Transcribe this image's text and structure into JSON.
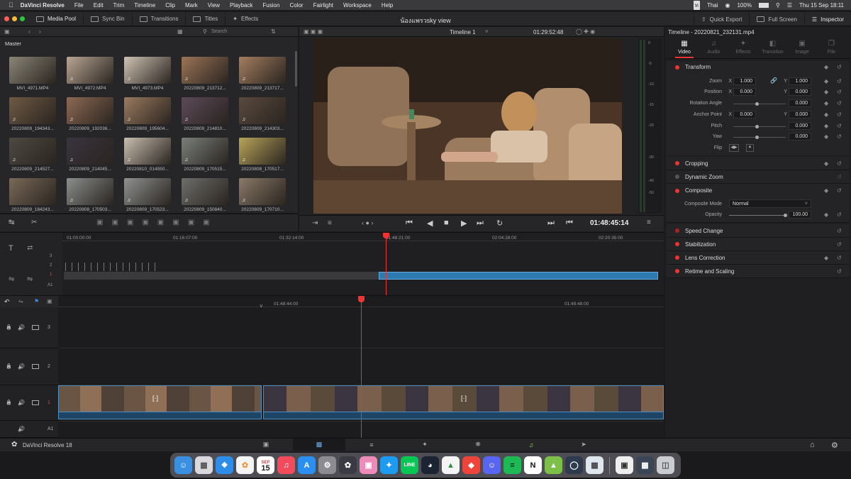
{
  "menubar": {
    "app_name": "DaVinci Resolve",
    "items": [
      "File",
      "Edit",
      "Trim",
      "Timeline",
      "Clip",
      "Mark",
      "View",
      "Playback",
      "Fusion",
      "Color",
      "Fairlight",
      "Workspace",
      "Help"
    ],
    "input_source": "Thai",
    "battery": "100%",
    "datetime": "Thu 15 Sep 18:11"
  },
  "toolbar": {
    "media_pool": "Media Pool",
    "sync_bin": "Sync Bin",
    "transitions": "Transitions",
    "titles": "Titles",
    "effects": "Effects",
    "project_title": "น้องแพรวsky view",
    "quick_export": "Quick Export",
    "full_screen": "Full Screen",
    "inspector": "Inspector"
  },
  "media_pool": {
    "search_placeholder": "Search",
    "bin_name": "Master",
    "clips": [
      {
        "name": "MVI_4971.MP4",
        "audio": false,
        "color": "#8a8576"
      },
      {
        "name": "MVI_4972.MP4",
        "audio": true,
        "color": "#b9a694"
      },
      {
        "name": "MVI_4973.MP4",
        "audio": true,
        "color": "#cfc3b3"
      },
      {
        "name": "20220809_213712...",
        "audio": true,
        "color": "#9b7457"
      },
      {
        "name": "20220809_213717...",
        "audio": true,
        "color": "#a37e5f"
      },
      {
        "name": "20220809_194343...",
        "audio": true,
        "color": "#6f5a44"
      },
      {
        "name": "20220809_192036...",
        "audio": true,
        "color": "#8d6a54"
      },
      {
        "name": "20220809_195604...",
        "audio": true,
        "color": "#9a7a5e"
      },
      {
        "name": "20220809_214810...",
        "audio": true,
        "color": "#5c4a58"
      },
      {
        "name": "20220809_214303...",
        "audio": true,
        "color": "#5a4a3e"
      },
      {
        "name": "20220809_214527...",
        "audio": true,
        "color": "#4e4a42"
      },
      {
        "name": "20220809_214045...",
        "audio": true,
        "color": "#3a3440"
      },
      {
        "name": "20220810_014550...",
        "audio": true,
        "color": "#c9bfb0"
      },
      {
        "name": "20220809_170515...",
        "audio": true,
        "color": "#7a7f7a"
      },
      {
        "name": "20220808_170517...",
        "audio": true,
        "color": "#b7a45a"
      },
      {
        "name": "20220809_184243...",
        "audio": false,
        "color": "#7a6a58"
      },
      {
        "name": "20220808_170503...",
        "audio": true,
        "color": "#8a8e8c"
      },
      {
        "name": "20220809_170523...",
        "audio": true,
        "color": "#8f9290"
      },
      {
        "name": "20220809_150840...",
        "audio": true,
        "color": "#6e6e6a"
      },
      {
        "name": "20220809_170710...",
        "audio": true,
        "color": "#8a7a68"
      }
    ]
  },
  "viewer": {
    "timeline_name": "Timeline 1",
    "source_timecode": "01:29:52:48",
    "current_timecode": "01:48:45:14",
    "meter_labels": [
      "0",
      "-5",
      "-10",
      "-15",
      "-20",
      "-30",
      "-40",
      "-50"
    ]
  },
  "upper_timeline": {
    "ruler": [
      "01:00:00:00",
      "01:16:07:00",
      "01:32:14:00",
      "01:48:21:00",
      "02:04:28:00",
      "02:20:35:00"
    ],
    "tracks": [
      "3",
      "2",
      "1",
      "A1"
    ]
  },
  "lower_timeline": {
    "ruler": [
      "01:48:44:00",
      "01:48:48:00"
    ],
    "tracks": [
      {
        "id": "3",
        "type": "video"
      },
      {
        "id": "2",
        "type": "video"
      },
      {
        "id": "1",
        "type": "video"
      },
      {
        "id": "A1",
        "type": "audio"
      }
    ]
  },
  "inspector": {
    "clip_title": "Timeline - 20220821_232131.mp4",
    "tabs": [
      {
        "label": "Video",
        "active": true
      },
      {
        "label": "Audio",
        "active": false
      },
      {
        "label": "Effects",
        "active": false
      },
      {
        "label": "Transition",
        "active": false
      },
      {
        "label": "Image",
        "active": false
      },
      {
        "label": "File",
        "active": false
      }
    ],
    "transform": {
      "header": "Transform",
      "zoom_label": "Zoom",
      "zoom_x": "1.000",
      "zoom_y": "1.000",
      "position_label": "Position",
      "position_x": "0.000",
      "position_y": "0.000",
      "rotation_label": "Rotation Angle",
      "rotation": "0.000",
      "anchor_label": "Anchor Point",
      "anchor_x": "0.000",
      "anchor_y": "0.000",
      "pitch_label": "Pitch",
      "pitch": "0.000",
      "yaw_label": "Yaw",
      "yaw": "0.000",
      "flip_label": "Flip",
      "x_label": "X",
      "y_label": "Y"
    },
    "cropping": "Cropping",
    "dynamic_zoom": "Dynamic Zoom",
    "composite": {
      "header": "Composite",
      "mode_label": "Composite Mode",
      "mode_value": "Normal",
      "opacity_label": "Opacity",
      "opacity_value": "100.00"
    },
    "sections": [
      "Speed Change",
      "Stabilization",
      "Lens Correction",
      "Retime and Scaling"
    ]
  },
  "footer": {
    "app_label": "DaVinci Resolve 18"
  },
  "dock": {
    "calendar_month": "SEP",
    "calendar_day": "15",
    "apps": [
      "finder",
      "launchpad",
      "safari",
      "photos",
      "calendar",
      "music",
      "app-store",
      "system-preferences",
      "davinci-resolve",
      "marker",
      "twitter",
      "line",
      "speed",
      "drive",
      "anydesk",
      "discord",
      "spotify",
      "notion",
      "android",
      "vpn",
      "preview",
      "screenshot",
      "trash"
    ]
  }
}
